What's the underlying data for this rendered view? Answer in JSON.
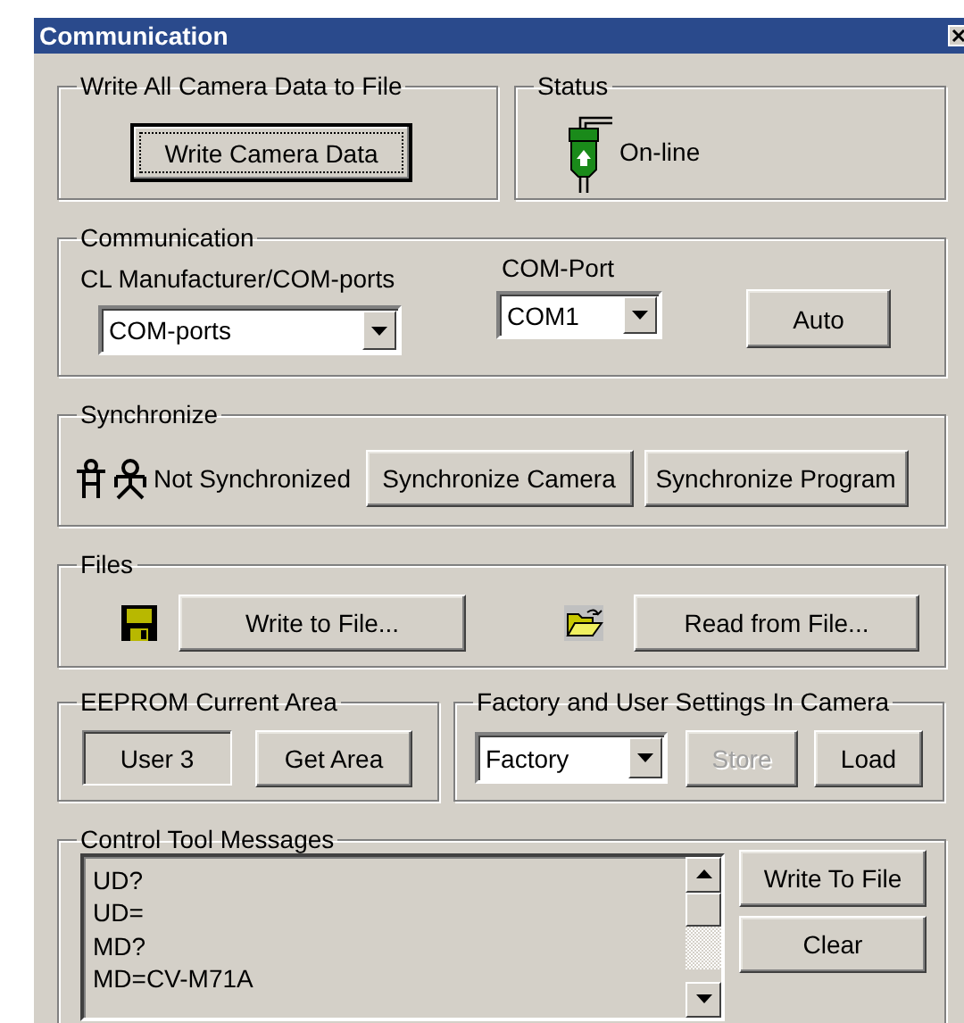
{
  "window": {
    "title": "Communication"
  },
  "write_all": {
    "title": "Write All Camera Data to File",
    "button": {
      "label": "Write Camera Data",
      "focused": true
    }
  },
  "status": {
    "title": "Status",
    "state": "On-line"
  },
  "communication": {
    "title": "Communication",
    "manufacturer": {
      "label": "CL Manufacturer/COM-ports",
      "value": "COM-ports"
    },
    "port": {
      "label": "COM-Port",
      "value": "COM1"
    },
    "button": {
      "label": "Auto"
    }
  },
  "synchronize": {
    "title": "Synchronize",
    "state": "Not Synchronized",
    "buttons": [
      {
        "label": "Synchronize Camera"
      },
      {
        "label": "Synchronize Program"
      }
    ]
  },
  "files": {
    "title": "Files",
    "buttons": [
      {
        "kind": "save",
        "label": "Write to File..."
      },
      {
        "kind": "open",
        "label": "Read from File..."
      }
    ]
  },
  "eeprom": {
    "title": "EEPROM Current Area",
    "value": "User 3",
    "button": {
      "label": "Get Area"
    }
  },
  "settings": {
    "title": "Factory and User Settings In Camera",
    "value": "Factory",
    "buttons": [
      {
        "label": "Store",
        "disabled": true
      },
      {
        "label": "Load",
        "disabled": false
      }
    ]
  },
  "messages": {
    "title": "Control Tool Messages",
    "lines": [
      "UD?",
      "UD=",
      "MD?",
      "MD=CV-M71A"
    ],
    "buttons": [
      {
        "label": "Write To File"
      },
      {
        "label": "Clear"
      }
    ]
  }
}
